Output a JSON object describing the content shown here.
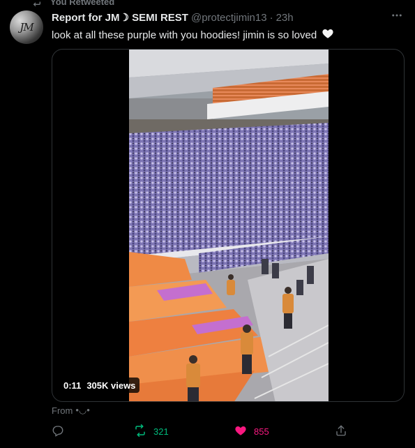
{
  "retweet_context": {
    "label": "You Retweeted"
  },
  "author": {
    "display_name": "Report for JM☽ SEMI REST",
    "handle": "@protectjimin13",
    "separator": "·",
    "time": "23h",
    "avatar_monogram": "JM"
  },
  "tweet": {
    "text": "look at all these purple with you hoodies! jimin is so loved",
    "emoji": "white-heart"
  },
  "media": {
    "type": "video",
    "duration": "0:11",
    "views": "305K views",
    "scene_colors": {
      "crowd": "#8d84c2",
      "banner": "#f08a46",
      "roof": "#e6e6ea"
    }
  },
  "source": {
    "prefix": "From",
    "name": "•◡•"
  },
  "actions": {
    "reply_count": "",
    "retweet_count": "321",
    "like_count": "855",
    "retweeted": true,
    "liked": true
  },
  "colors": {
    "background": "#000000",
    "text_primary": "#e7e9ea",
    "text_secondary": "#71767b",
    "retweet_green": "#00ba7c",
    "like_pink": "#f91880",
    "border": "#2f3336"
  },
  "icons": [
    "retweet-icon",
    "more-icon",
    "reply-icon",
    "like-icon",
    "share-icon",
    "heart-emoji"
  ]
}
